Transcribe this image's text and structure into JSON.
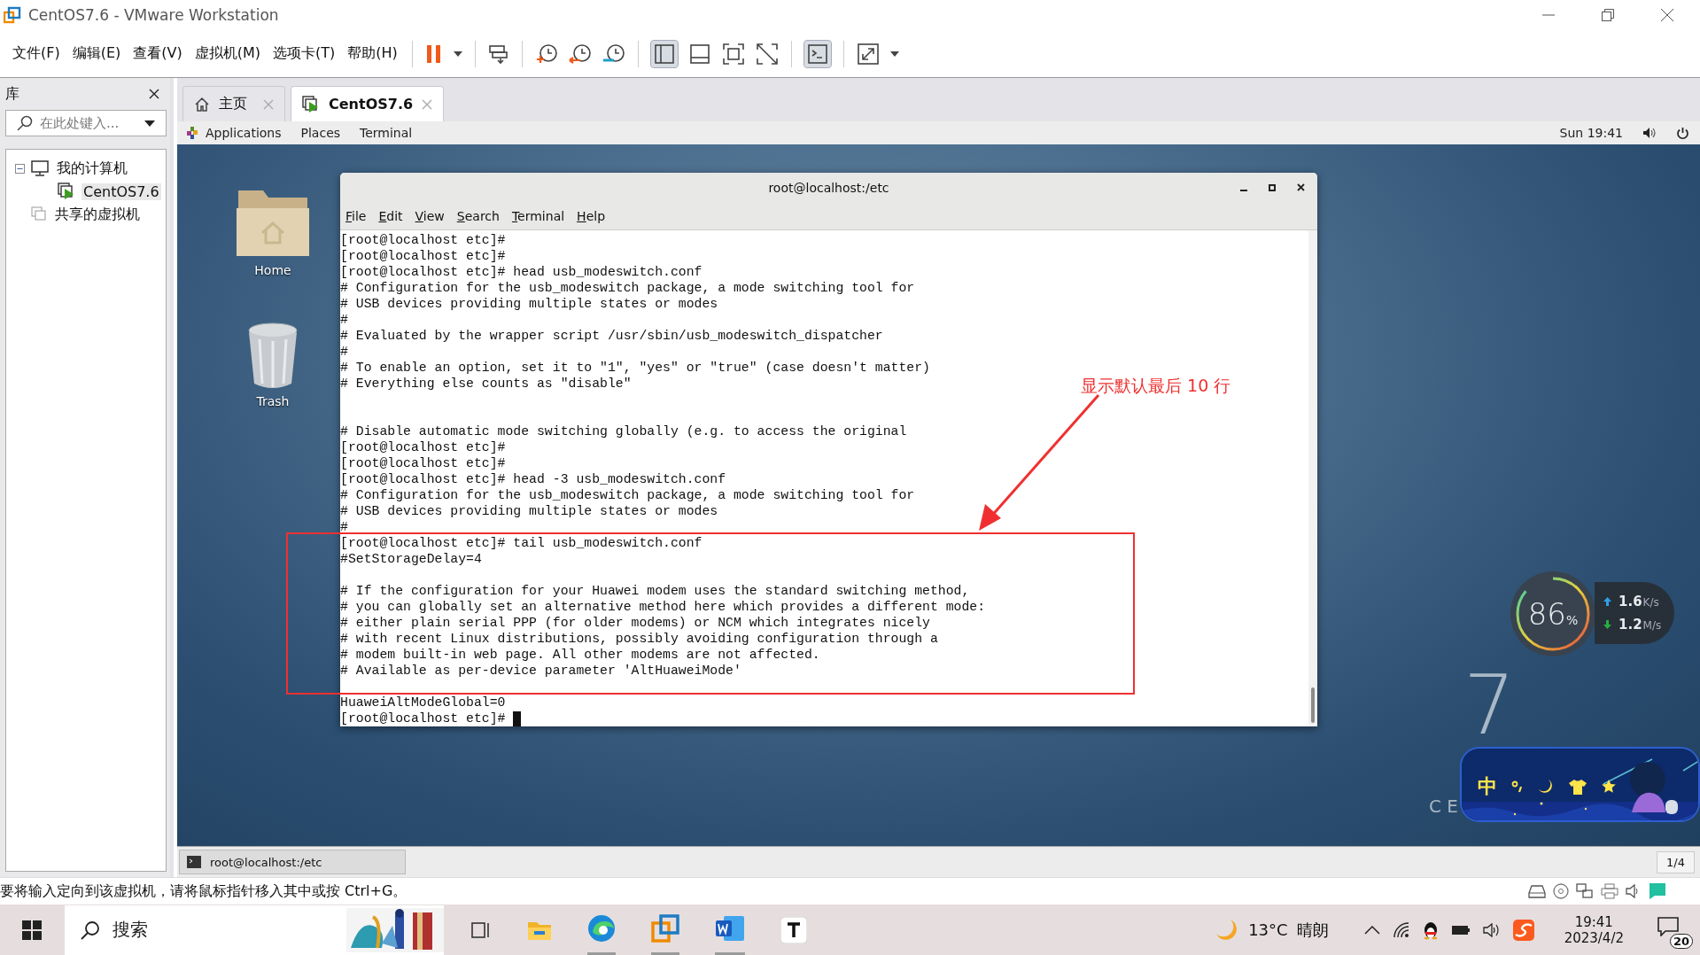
{
  "window": {
    "title": "CentOS7.6 - VMware Workstation"
  },
  "menu": [
    "文件(F)",
    "编辑(E)",
    "查看(V)",
    "虚拟机(M)",
    "选项卡(T)",
    "帮助(H)"
  ],
  "library": {
    "title": "库",
    "search": {
      "placeholder": "在此处键入..."
    },
    "tree": [
      {
        "label": "我的计算机",
        "kind": "computer",
        "selected": false,
        "expanded": true,
        "children": [
          {
            "label": "CentOS7.6",
            "kind": "vm",
            "selected": true
          }
        ]
      },
      {
        "label": "共享的虚拟机",
        "kind": "shared",
        "selected": false
      }
    ]
  },
  "tabs": [
    {
      "label": "主页",
      "kind": "home",
      "selected": false
    },
    {
      "label": "CentOS7.6",
      "kind": "vm",
      "selected": true
    }
  ],
  "gnome_bar": {
    "menus": [
      "Applications",
      "Places",
      "Terminal"
    ],
    "clock": "Sun 19:41"
  },
  "desktop": {
    "icons": [
      {
        "label": "Home",
        "kind": "folder"
      },
      {
        "label": "Trash",
        "kind": "trash"
      }
    ],
    "wallpaper_text": [
      "7",
      "C E"
    ]
  },
  "terminal": {
    "title": "root@localhost:/etc",
    "menu": [
      "File",
      "Edit",
      "View",
      "Search",
      "Terminal",
      "Help"
    ],
    "lines": [
      {
        "kind": "line",
        "text": "[root@localhost etc]#"
      },
      {
        "kind": "line",
        "text": "[root@localhost etc]#"
      },
      {
        "kind": "line",
        "text": "[root@localhost etc]# head usb_modeswitch.conf"
      },
      {
        "kind": "line",
        "text": "# Configuration for the usb_modeswitch package, a mode switching tool for"
      },
      {
        "kind": "line",
        "text": "# USB devices providing multiple states or modes"
      },
      {
        "kind": "line",
        "text": "#"
      },
      {
        "kind": "line",
        "text": "# Evaluated by the wrapper script /usr/sbin/usb_modeswitch_dispatcher"
      },
      {
        "kind": "line",
        "text": "#"
      },
      {
        "kind": "line",
        "text": "# To enable an option, set it to \"1\", \"yes\" or \"true\" (case doesn't matter)"
      },
      {
        "kind": "line",
        "text": "# Everything else counts as \"disable\""
      },
      {
        "kind": "blank"
      },
      {
        "kind": "blank"
      },
      {
        "kind": "line",
        "text": "# Disable automatic mode switching globally (e.g. to access the original"
      },
      {
        "kind": "line",
        "text": "[root@localhost etc]#"
      },
      {
        "kind": "line",
        "text": "[root@localhost etc]#"
      },
      {
        "kind": "line",
        "text": "[root@localhost etc]# head -3 usb_modeswitch.conf"
      },
      {
        "kind": "line",
        "text": "# Configuration for the usb_modeswitch package, a mode switching tool for"
      },
      {
        "kind": "line",
        "text": "# USB devices providing multiple states or modes"
      },
      {
        "kind": "line",
        "text": "#"
      },
      {
        "kind": "line",
        "text": "[root@localhost etc]# tail usb_modeswitch.conf"
      },
      {
        "kind": "line",
        "text": "#SetStorageDelay=4"
      },
      {
        "kind": "blank"
      },
      {
        "kind": "line",
        "text": "# If the configuration for your Huawei modem uses the standard switching method,"
      },
      {
        "kind": "line",
        "text": "# you can globally set an alternative method here which provides a different mode:"
      },
      {
        "kind": "line",
        "text": "# either plain serial PPP (for older modems) or NCM which integrates nicely"
      },
      {
        "kind": "line",
        "text": "# with recent Linux distributions, possibly avoiding configuration through a"
      },
      {
        "kind": "line",
        "text": "# modem built-in web page. All other modems are not affected."
      },
      {
        "kind": "line",
        "text": "# Available as per-device parameter 'AltHuaweiMode'"
      },
      {
        "kind": "blank"
      },
      {
        "kind": "line",
        "text": "HuaweiAltModeGlobal=0"
      },
      {
        "kind": "cursor",
        "text": "[root@localhost etc]#"
      }
    ]
  },
  "annotation": {
    "text": "显示默认最后 10 行"
  },
  "net_widget": {
    "cpu": "86",
    "cpu_unit": "%",
    "up": "1.6",
    "up_unit": "K/s",
    "down": "1.2",
    "down_unit": "M/s"
  },
  "ime_bar": {
    "mode": "中"
  },
  "vm_bar": {
    "task": "root@localhost:/etc",
    "page": "1/4"
  },
  "status": "要将输入定向到该虚拟机，请将鼠标指针移入其中或按 Ctrl+G。",
  "taskbar": {
    "search": "搜索",
    "weather": {
      "temp": "13°C",
      "condition": "晴朗"
    },
    "time": "19:41",
    "date": "2023/4/2",
    "notifications": "20"
  }
}
